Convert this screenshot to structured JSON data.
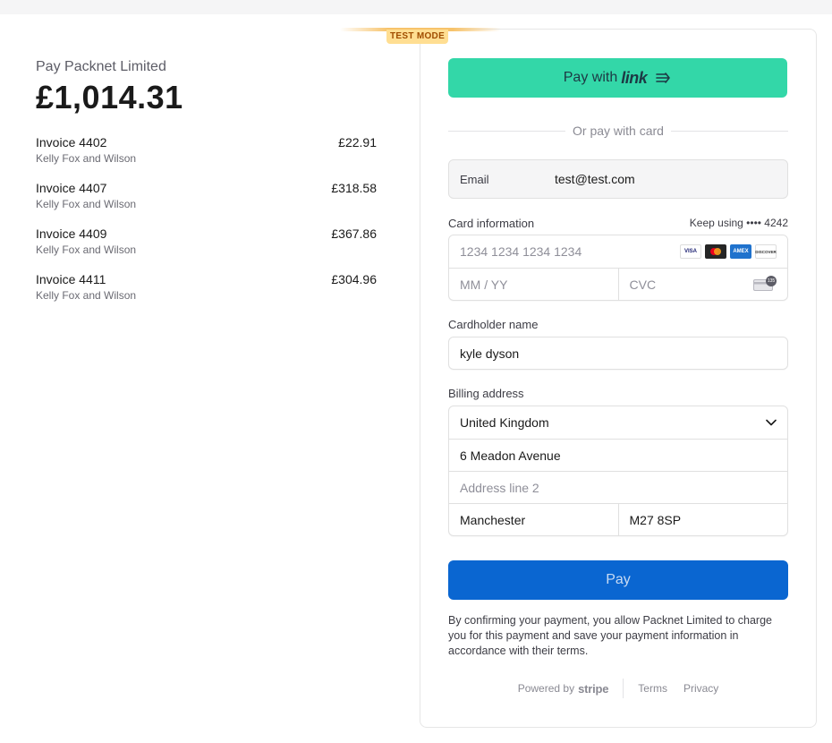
{
  "summary": {
    "merchant": "Pay Packnet Limited",
    "total": "£1,014.31",
    "items": [
      {
        "name": "Invoice 4402",
        "sub": "Kelly Fox and Wilson",
        "amount": "£22.91"
      },
      {
        "name": "Invoice 4407",
        "sub": "Kelly Fox and Wilson",
        "amount": "£318.58"
      },
      {
        "name": "Invoice 4409",
        "sub": "Kelly Fox and Wilson",
        "amount": "£367.86"
      },
      {
        "name": "Invoice 4411",
        "sub": "Kelly Fox and Wilson",
        "amount": "£304.96"
      }
    ]
  },
  "test_mode": "TEST MODE",
  "link_button": {
    "prefix": "Pay with",
    "brand": "link"
  },
  "divider_text": "Or pay with card",
  "email": {
    "label": "Email",
    "value": "test@test.com"
  },
  "card": {
    "label": "Card information",
    "keep_using": "Keep using •••• 4242",
    "number_placeholder": "1234 1234 1234 1234",
    "expiry_placeholder": "MM / YY",
    "cvc_placeholder": "CVC",
    "brands": [
      "VISA",
      "mastercard",
      "AMEX",
      "DISCOVER"
    ],
    "cvc_hint": "135"
  },
  "cardholder": {
    "label": "Cardholder name",
    "value": "kyle dyson"
  },
  "billing": {
    "label": "Billing address",
    "country": "United Kingdom",
    "line1": "6 Meadon Avenue",
    "line2_placeholder": "Address line 2",
    "city": "Manchester",
    "postcode": "M27 8SP"
  },
  "pay_button": "Pay",
  "consent": "By confirming your payment, you allow Packnet Limited to charge you for this payment and save your payment information in accordance with their terms.",
  "footer": {
    "powered_by": "Powered by",
    "stripe": "stripe",
    "terms": "Terms",
    "privacy": "Privacy"
  },
  "colors": {
    "link_green": "#33d7a8",
    "pay_blue": "#0a66d1",
    "test_badge": "#ffde92"
  }
}
